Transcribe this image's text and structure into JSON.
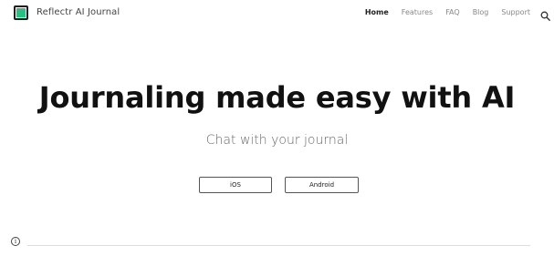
{
  "header": {
    "site_title": "Reflectr AI Journal",
    "logo_icon": "app-logo-icon",
    "accent_color": "#27c281",
    "nav": [
      {
        "label": "Home",
        "active": true
      },
      {
        "label": "Features",
        "active": false
      },
      {
        "label": "FAQ",
        "active": false
      },
      {
        "label": "Blog",
        "active": false
      },
      {
        "label": "Support",
        "active": false
      }
    ],
    "search_icon": "search-icon"
  },
  "hero": {
    "title": "Journaling made easy with AI",
    "subtitle": "Chat with your journal",
    "buttons": {
      "ios_label": "iOS",
      "android_label": "Android"
    }
  },
  "footer": {
    "info_icon": "info-icon",
    "info_glyph": "i"
  }
}
